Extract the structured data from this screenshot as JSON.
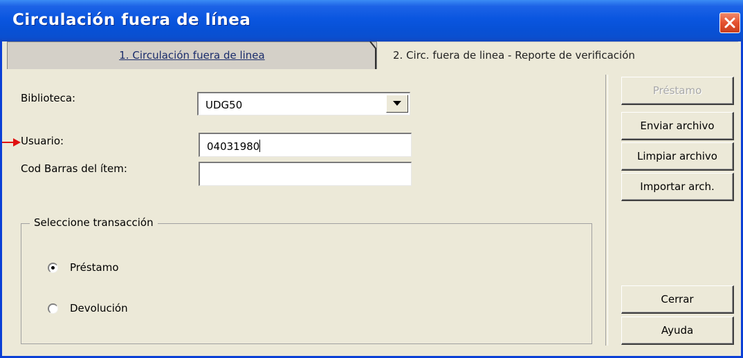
{
  "window": {
    "title": "Circulación fuera de línea"
  },
  "tabs": [
    {
      "label": "1. Circulación fuera de linea",
      "active": true
    },
    {
      "label": "2. Circ. fuera de linea - Reporte de verificación",
      "active": false
    }
  ],
  "form": {
    "biblioteca_label": "Biblioteca:",
    "biblioteca_value": "UDG50",
    "usuario_label": "Usuario:",
    "usuario_value": "04031980",
    "codbarras_label": "Cod Barras del ítem:",
    "codbarras_value": ""
  },
  "transaction": {
    "legend": "Seleccione transacción",
    "options": [
      {
        "label": "Préstamo",
        "selected": true
      },
      {
        "label": "Devolución",
        "selected": false
      }
    ]
  },
  "buttons": {
    "prestamo": "Préstamo",
    "enviar": "Enviar archivo",
    "limpiar": "Limpiar archivo",
    "importar": "Importar arch.",
    "cerrar": "Cerrar",
    "ayuda": "Ayuda"
  },
  "colors": {
    "titlebar": "#0a56e0",
    "window_bg": "#ece9d8",
    "arrow": "#e01010"
  }
}
